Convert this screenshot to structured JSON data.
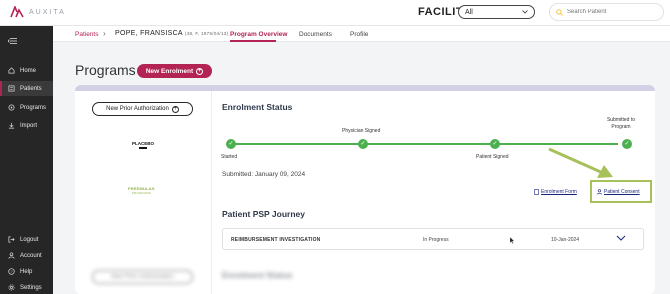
{
  "header": {
    "logo_text": "AUXITA",
    "facility_label": "FACILITY",
    "facility_selected": "All",
    "search_placeholder": "Search Patient"
  },
  "sidebar": {
    "items": [
      {
        "label": "Home",
        "icon": "home-icon"
      },
      {
        "label": "Patients",
        "icon": "patients-icon",
        "active": true
      },
      {
        "label": "Programs",
        "icon": "programs-icon"
      },
      {
        "label": "Import",
        "icon": "import-icon"
      }
    ],
    "bottom_items": [
      {
        "label": "Logout",
        "icon": "logout-icon"
      },
      {
        "label": "Account",
        "icon": "account-icon"
      },
      {
        "label": "Help",
        "icon": "help-icon"
      },
      {
        "label": "Settings",
        "icon": "settings-icon"
      }
    ]
  },
  "subheader": {
    "breadcrumb": "Patients",
    "patient_name": "POPE, FRANSISCA",
    "patient_meta": "(48, F, 1975/04/13)",
    "tabs": [
      "Program Overview",
      "Documents",
      "Profile"
    ],
    "active_tab": "Program Overview"
  },
  "page": {
    "title": "Programs",
    "new_enrolment": "New Enrolment"
  },
  "card": {
    "prior_auth_button": "New Prior Authorization",
    "program_logo_1": "PLACEBO",
    "program_logo_2": "FREEMULAS",
    "program_logo_2_sub": "PROGRAMS",
    "enrolment_title": "Enrolment Status",
    "steps": [
      {
        "label": "Started",
        "done": true
      },
      {
        "label": "Physician Signed",
        "done": true
      },
      {
        "label": "Patient Signed",
        "done": true
      },
      {
        "label": "Submitted to Program",
        "done": true
      }
    ],
    "submitted_text": "Submitted: January 09, 2024",
    "enrolment_form_link": "Enrolment Form",
    "patient_consent_link": "Patient Consent",
    "journey_title": "Patient PSP Journey",
    "journey_row": {
      "name": "REIMBURSEMENT INVESTIGATION",
      "status": "In Progress",
      "date": "10-Jan-2024"
    }
  },
  "blurred_card": {
    "button": "New Prior Authorization",
    "title": "Enrolment Status"
  },
  "colors": {
    "brand": "#b32455",
    "success": "#4caf50",
    "highlight": "#a6c05a",
    "sidebar": "#262626"
  }
}
